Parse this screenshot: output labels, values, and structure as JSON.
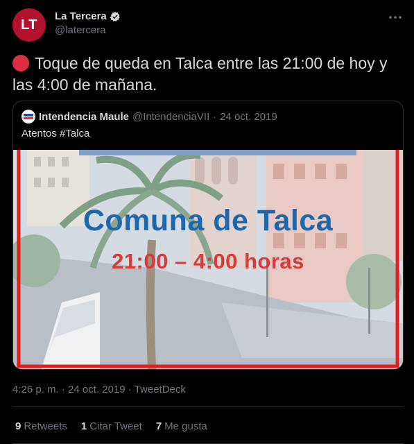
{
  "author": {
    "name": "La Tercera",
    "handle": "@latercera",
    "avatar_text": "LT",
    "avatar_color": "#b3122e",
    "verified_icon": "verified-badge-icon"
  },
  "tweet": {
    "emoji_icon": "red-circle-icon",
    "text": "Toque de queda en Talca entre las 21:00 de hoy y las 4:00 de mañana."
  },
  "quote": {
    "name": "Intendencia Maule",
    "handle": "@IntendenciaVII",
    "separator": "·",
    "date": "24 oct. 2019",
    "text": "Atentos #Talca",
    "image": {
      "title": "Comuna de Talca",
      "subtitle": "21:00 – 4:00 horas",
      "title_color": "#1d67ad",
      "subtitle_color": "#d63a3a",
      "frame_color": "#e02020"
    }
  },
  "meta": {
    "time": "4:26 p. m.",
    "separator": "·",
    "date": "24 oct. 2019",
    "source": "TweetDeck"
  },
  "stats": {
    "retweets": {
      "count": "9",
      "label": "Retweets"
    },
    "quotes": {
      "count": "1",
      "label": "Citar Tweet"
    },
    "likes": {
      "count": "7",
      "label": "Me gusta"
    }
  },
  "colors": {
    "background": "#000000",
    "text": "#d9d9d9",
    "secondary": "#6e767d",
    "border": "#2f3336"
  }
}
